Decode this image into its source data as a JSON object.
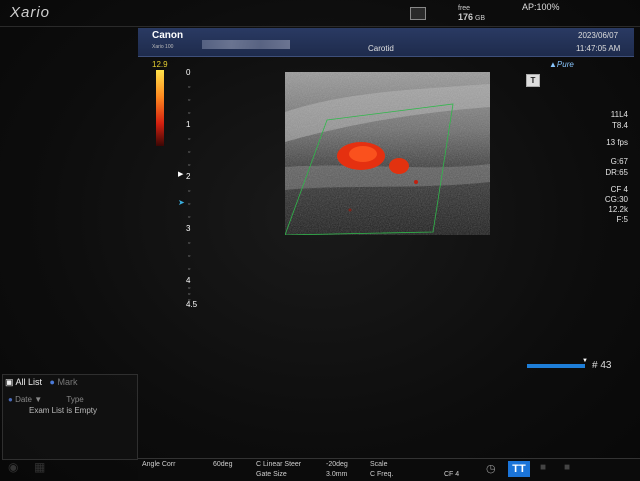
{
  "top_bar": {
    "brand": "Xario",
    "storage_label": "free",
    "storage_value": "176",
    "storage_unit": "GB",
    "ap": "AP:100%"
  },
  "header": {
    "logo": "Canon",
    "model": "Xario 100",
    "exam_name": "Carotid",
    "date": "2023/06/07",
    "time": "11:47:05 AM"
  },
  "color_scale": {
    "max": "12.9"
  },
  "depth_scale": {
    "labels": [
      "0",
      "1",
      "2",
      "3",
      "4",
      "4.5"
    ]
  },
  "image_params": {
    "mode_tag": "Pure",
    "t_button": "T",
    "probe": "11L4",
    "freq": "T8.4",
    "fps": "13 fps",
    "gain": "G:67",
    "dr": "DR:65",
    "cf": "CF 4",
    "cg": "CG:30",
    "prf": "12.2k",
    "filter": "F:5"
  },
  "gain_bar": {
    "value": "# 43"
  },
  "exam_list": {
    "tab_all": "All List",
    "tab_mark": "Mark",
    "col_date": "Date",
    "col_type": "Type",
    "empty_msg": "Exam List is Empty"
  },
  "bottom_bar": {
    "angle_corr_label": "Angle Corr",
    "angle_corr_value": "60deg",
    "linear_steer_label": "C Linear Steer",
    "linear_steer_value": "-20deg",
    "gate_size_label": "Gate Size",
    "gate_size_value": "3.0mm",
    "scale_label": "Scale",
    "cfreq_label": "C Freq.",
    "cfreq_value": "CF 4",
    "tt_label": "TT"
  }
}
